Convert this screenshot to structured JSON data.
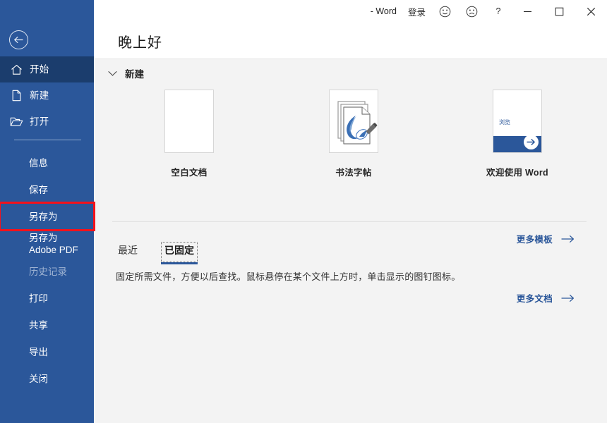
{
  "colors": {
    "sidebar_blue": "#2b579a",
    "sidebar_active": "#1b3d6d",
    "accent": "#2b579a",
    "highlight_red": "#f4121b",
    "content_bg": "#f3f3f3"
  },
  "titlebar": {
    "app_suffix": "- Word",
    "sign_in": "登录",
    "smile_icon": "smiley-face-icon",
    "frown_icon": "frowning-face-icon",
    "help": "?",
    "minimize": "minimize-icon",
    "maximize": "maximize-icon",
    "close": "close-icon"
  },
  "sidebar": {
    "back_icon": "back-arrow-icon",
    "top_items": [
      {
        "label": "开始",
        "icon": "home-icon",
        "active": true
      },
      {
        "label": "新建",
        "icon": "new-document-icon",
        "active": false
      },
      {
        "label": "打开",
        "icon": "open-folder-icon",
        "active": false
      }
    ],
    "items": [
      {
        "label": "信息",
        "disabled": false,
        "highlighted": false
      },
      {
        "label": "保存",
        "disabled": false,
        "highlighted": false
      },
      {
        "label": "另存为",
        "disabled": false,
        "highlighted": true
      },
      {
        "label": "另存为 Adobe PDF",
        "disabled": false,
        "highlighted": false
      },
      {
        "label": "历史记录",
        "disabled": true,
        "highlighted": false
      },
      {
        "label": "打印",
        "disabled": false,
        "highlighted": false
      },
      {
        "label": "共享",
        "disabled": false,
        "highlighted": false
      },
      {
        "label": "导出",
        "disabled": false,
        "highlighted": false
      },
      {
        "label": "关闭",
        "disabled": false,
        "highlighted": false
      }
    ]
  },
  "header": {
    "greeting": "晚上好"
  },
  "new_section": {
    "title": "新建",
    "chevron_icon": "chevron-down-icon",
    "templates": [
      {
        "caption": "空白文档",
        "kind": "blank"
      },
      {
        "caption": "书法字帖",
        "kind": "calligraphy"
      },
      {
        "caption": "欢迎使用 Word",
        "kind": "welcome",
        "thumb_label": "浏览"
      }
    ],
    "more_templates": "更多模板",
    "more_arrow_icon": "arrow-right-icon"
  },
  "documents_section": {
    "tabs": [
      {
        "label": "最近",
        "active": false
      },
      {
        "label": "已固定",
        "active": true
      }
    ],
    "pinned_description": "固定所需文件，方便以后查找。鼠标悬停在某个文件上方时，单击显示的图钉图标。",
    "more_documents": "更多文档",
    "more_arrow_icon": "arrow-right-icon"
  }
}
